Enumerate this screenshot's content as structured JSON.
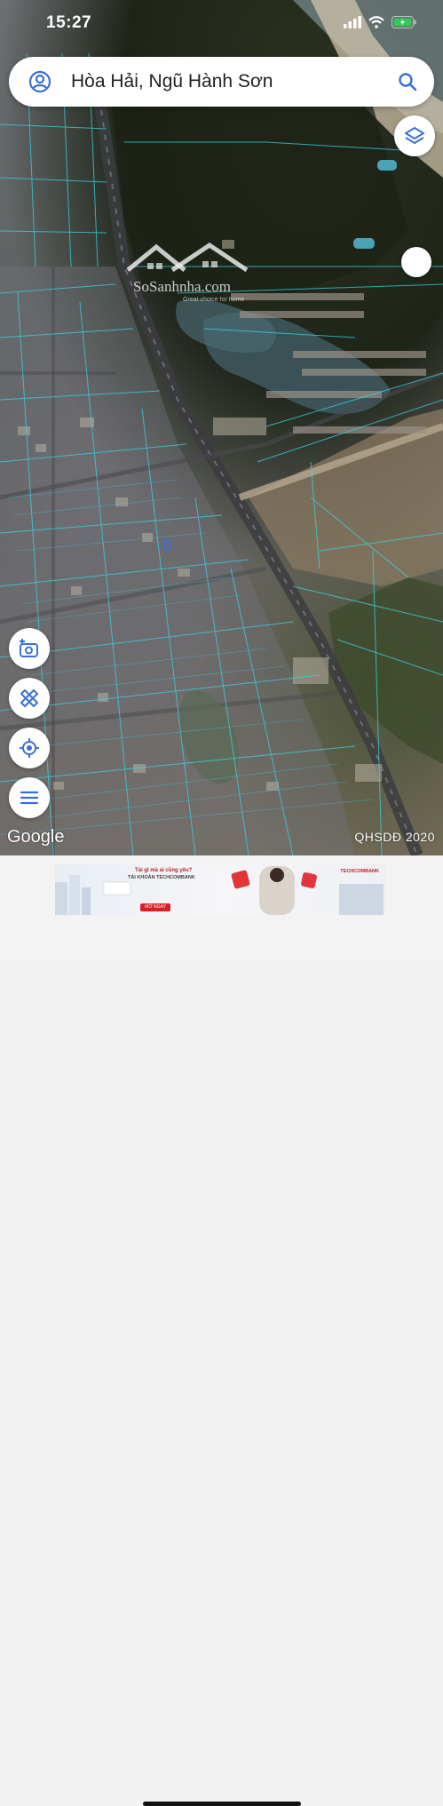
{
  "status_bar": {
    "time": "15:27"
  },
  "search": {
    "query": "Hòa Hải, Ngũ Hành Sơn"
  },
  "watermark": {
    "brand": "SoSanhnha.com",
    "tagline": "Great choice for home"
  },
  "map": {
    "logo": "Google",
    "attribution": "QHSDĐ 2020"
  },
  "icons": {
    "account": "account-circle-icon",
    "search": "search-icon",
    "layers": "layers-icon",
    "camera": "add-photo-icon",
    "measure": "ruler-pencil-icon",
    "locate": "my-location-icon",
    "menu": "menu-icon",
    "signal": "signal-icon",
    "wifi": "wifi-icon",
    "battery": "battery-charging-icon"
  },
  "colors": {
    "accent": "#3b6fd6",
    "parcel_lines": "#35d6e8",
    "battery": "#34c759"
  },
  "ad": {
    "line1": "Tài gì mà ai cũng yêu?",
    "line2": "TÀI KHOẢN TECHCOMBANK",
    "cta": "MỞ NGAY",
    "brand": "TECHCOMBANK"
  }
}
